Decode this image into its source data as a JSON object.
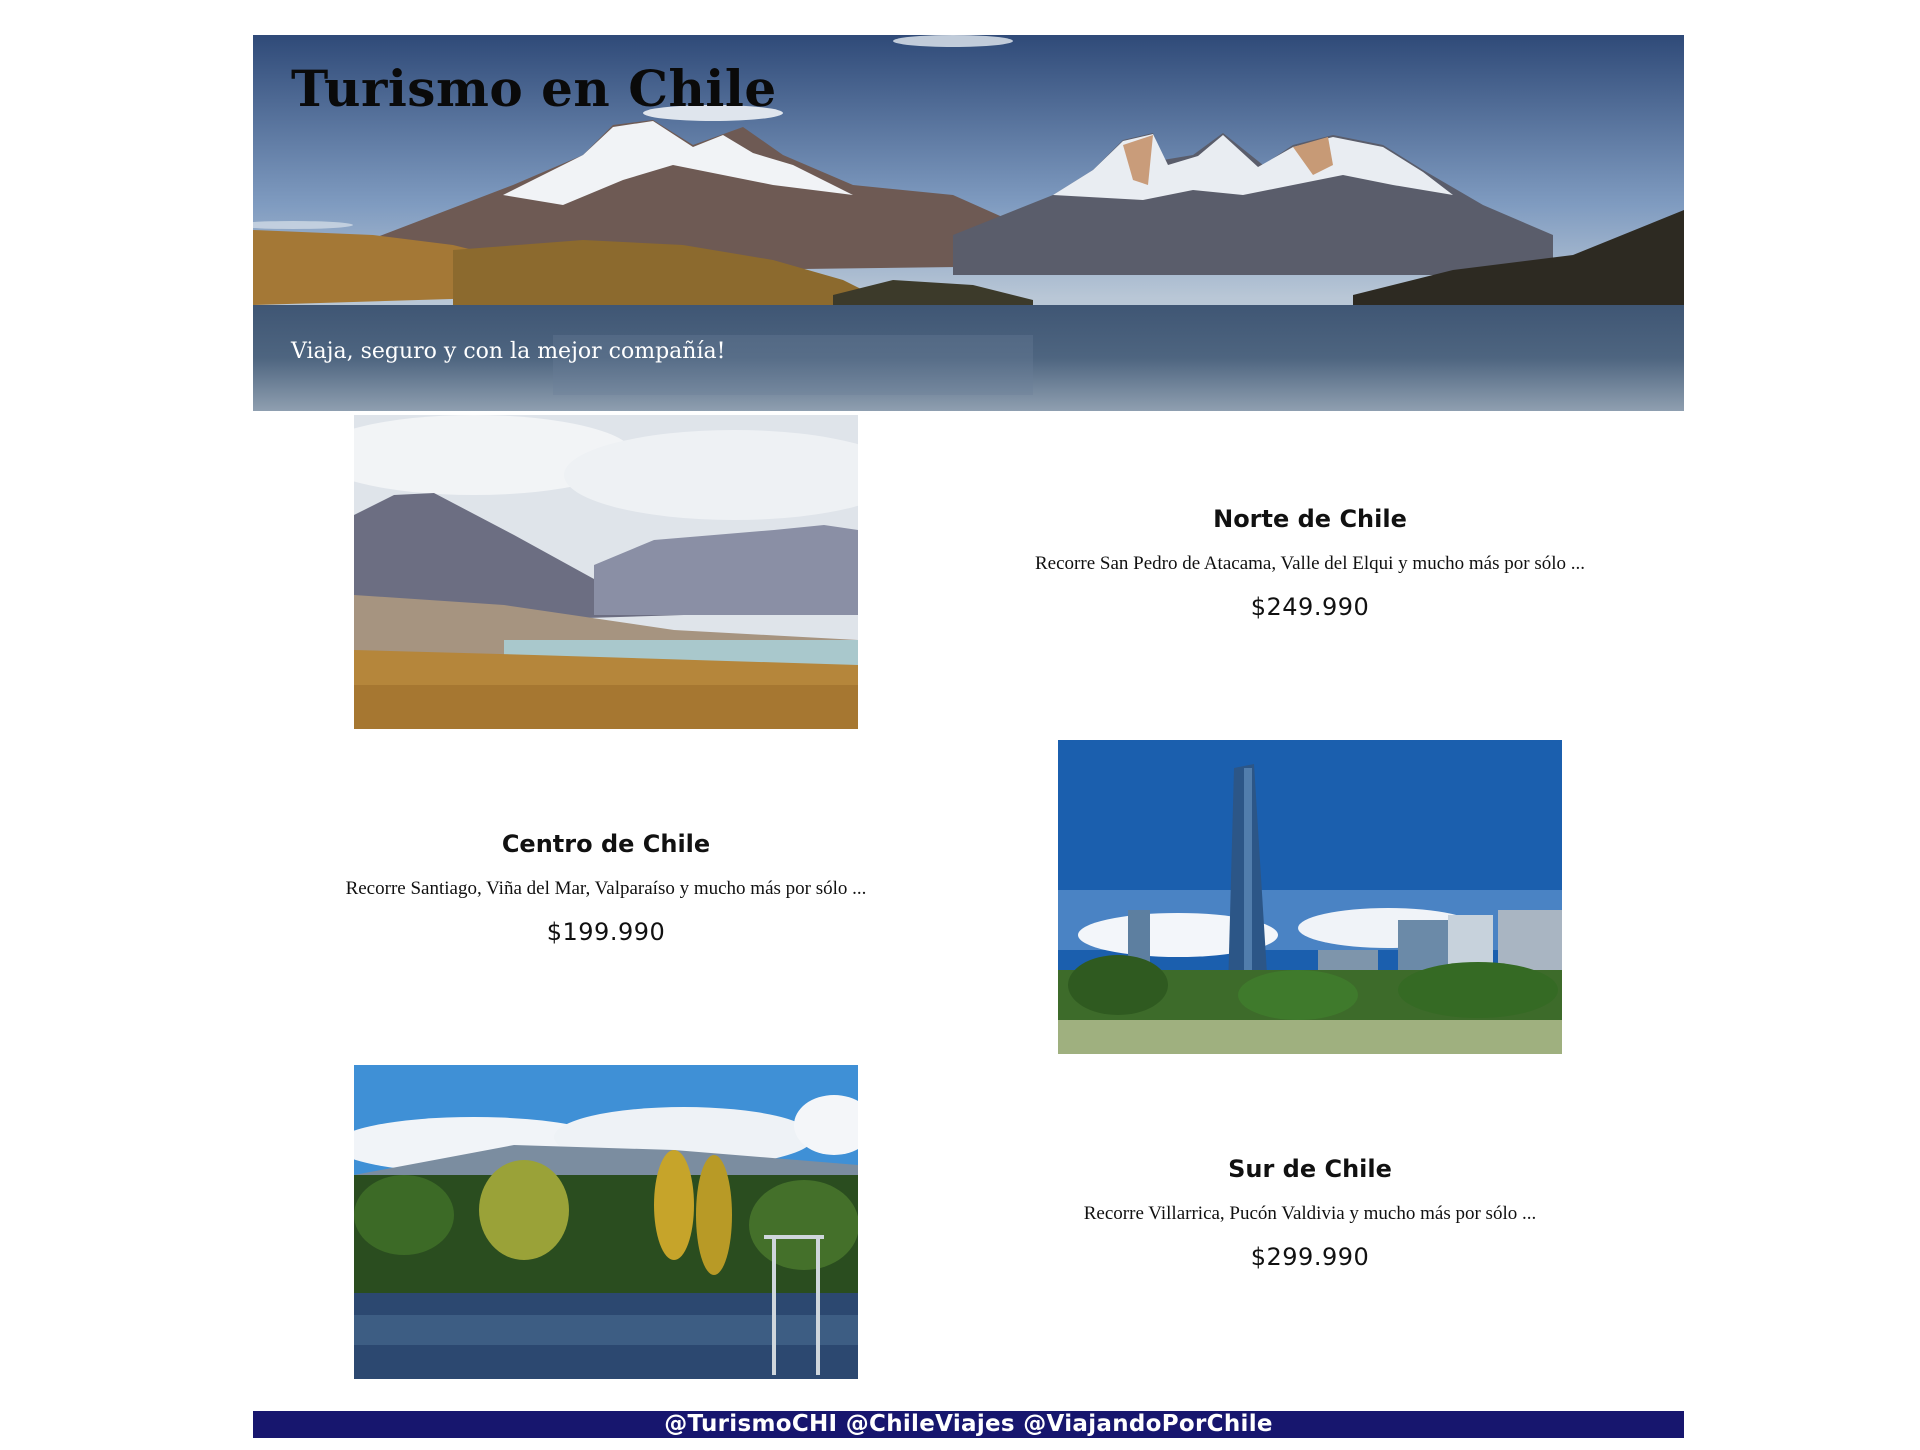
{
  "header": {
    "title": "Turismo en Chile",
    "subtitle": "Viaja, seguro y con la mejor compañía!"
  },
  "tours": [
    {
      "name": "Norte de Chile",
      "description": "Recorre San Pedro de Atacama, Valle del Elqui y mucho más por sólo ...",
      "price": "$249.990"
    },
    {
      "name": "Centro de Chile",
      "description": "Recorre Santiago, Viña del Mar, Valparaíso y mucho más por sólo ...",
      "price": "$199.990"
    },
    {
      "name": "Sur de Chile",
      "description": "Recorre Villarrica, Pucón Valdivia y mucho más por sólo ...",
      "price": "$299.990"
    }
  ],
  "footer": {
    "text": "@TurismoCHI @ChileViajes @ViajandoPorChile"
  },
  "colors": {
    "footer_bg": "#17166e",
    "footer_text": "#ffffff"
  }
}
